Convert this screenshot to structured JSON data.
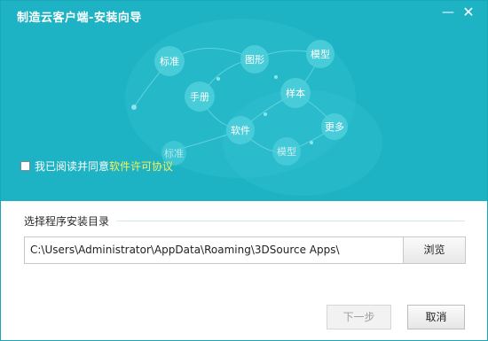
{
  "window": {
    "title": "制造云客户端-安装向导",
    "minimize_label": "—",
    "close_label": "✕"
  },
  "hero": {
    "bubbles": [
      "标准",
      "图形",
      "模型",
      "手册",
      "样本",
      "软件",
      "更多",
      "模型",
      "标准"
    ]
  },
  "agreement": {
    "prefix": "我已阅读并同意",
    "link_text": "软件许可协议",
    "checked": false
  },
  "install_dir": {
    "section_label": "选择程序安装目录",
    "path_value": "C:\\Users\\Administrator\\AppData\\Roaming\\3DSource Apps\\",
    "browse_label": "浏览"
  },
  "footer": {
    "next_label": "下一步",
    "cancel_label": "取消"
  },
  "colors": {
    "hero_bg": "#1db3c5",
    "link": "#f8f15a"
  }
}
